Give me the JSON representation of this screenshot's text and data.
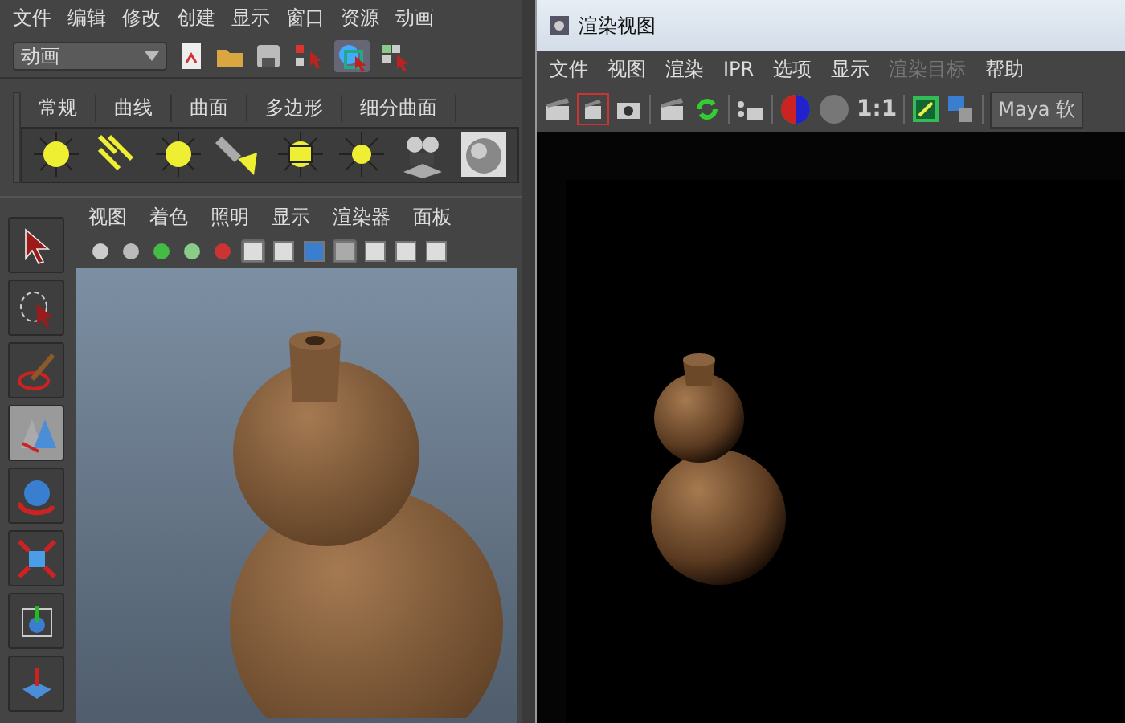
{
  "main_window": {
    "menu": [
      "文件",
      "编辑",
      "修改",
      "创建",
      "显示",
      "窗口",
      "资源",
      "动画"
    ],
    "mode_dropdown": {
      "value": "动画"
    },
    "shelf_tabs": [
      "常规",
      "曲线",
      "曲面",
      "多边形",
      "细分曲面"
    ],
    "tools": [
      {
        "selected": false
      },
      {
        "selected": false
      },
      {
        "selected": false
      },
      {
        "selected": true
      },
      {
        "selected": false
      },
      {
        "selected": false
      },
      {
        "selected": false
      },
      {
        "selected": false
      }
    ],
    "panel_menu": [
      "视图",
      "着色",
      "照明",
      "显示",
      "渲染器",
      "面板"
    ]
  },
  "render_window": {
    "title": "渲染视图",
    "menu": [
      {
        "label": "文件",
        "disabled": false
      },
      {
        "label": "视图",
        "disabled": false
      },
      {
        "label": "渲染",
        "disabled": false
      },
      {
        "label": "IPR",
        "disabled": false
      },
      {
        "label": "选项",
        "disabled": false
      },
      {
        "label": "显示",
        "disabled": false
      },
      {
        "label": "渲染目标",
        "disabled": true
      },
      {
        "label": "帮助",
        "disabled": false
      }
    ],
    "ratio_label": "1:1",
    "renderer_dropdown": {
      "value": "Maya 软"
    }
  }
}
